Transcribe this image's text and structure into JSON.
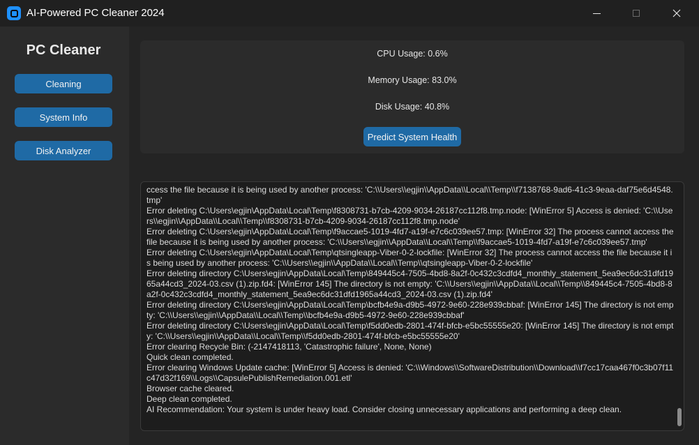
{
  "window": {
    "title": "AI-Powered PC Cleaner 2024"
  },
  "sidebar": {
    "title": "PC Cleaner",
    "items": [
      {
        "label": "Cleaning"
      },
      {
        "label": "System Info"
      },
      {
        "label": "Disk Analyzer"
      }
    ]
  },
  "stats": {
    "cpu": "CPU Usage: 0.6%",
    "memory": "Memory Usage: 83.0%",
    "disk": "Disk Usage: 40.8%",
    "predict_label": "Predict System Health"
  },
  "log": {
    "lines": [
      "ccess the file because it is being used by another process: 'C:\\\\Users\\\\egjin\\\\AppData\\\\Local\\\\Temp\\\\f7138768-9ad6-41c3-9eaa-daf75e6d4548.tmp'",
      "Error deleting C:\\Users\\egjin\\AppData\\Local\\Temp\\f8308731-b7cb-4209-9034-26187cc112f8.tmp.node: [WinError 5] Access is denied: 'C:\\\\Users\\\\egjin\\\\AppData\\\\Local\\\\Temp\\\\f8308731-b7cb-4209-9034-26187cc112f8.tmp.node'",
      "Error deleting C:\\Users\\egjin\\AppData\\Local\\Temp\\f9accae5-1019-4fd7-a19f-e7c6c039ee57.tmp: [WinError 32] The process cannot access the file because it is being used by another process: 'C:\\\\Users\\\\egjin\\\\AppData\\\\Local\\\\Temp\\\\f9accae5-1019-4fd7-a19f-e7c6c039ee57.tmp'",
      "Error deleting C:\\Users\\egjin\\AppData\\Local\\Temp\\qtsingleapp-Viber-0-2-lockfile: [WinError 32] The process cannot access the file because it is being used by another process: 'C:\\\\Users\\\\egjin\\\\AppData\\\\Local\\\\Temp\\\\qtsingleapp-Viber-0-2-lockfile'",
      "Error deleting directory C:\\Users\\egjin\\AppData\\Local\\Temp\\849445c4-7505-4bd8-8a2f-0c432c3cdfd4_monthly_statement_5ea9ec6dc31dfd1965a44cd3_2024-03.csv (1).zip.fd4: [WinError 145] The directory is not empty: 'C:\\\\Users\\\\egjin\\\\AppData\\\\Local\\\\Temp\\\\849445c4-7505-4bd8-8a2f-0c432c3cdfd4_monthly_statement_5ea9ec6dc31dfd1965a44cd3_2024-03.csv (1).zip.fd4'",
      "Error deleting directory C:\\Users\\egjin\\AppData\\Local\\Temp\\bcfb4e9a-d9b5-4972-9e60-228e939cbbaf: [WinError 145] The directory is not empty: 'C:\\\\Users\\\\egjin\\\\AppData\\\\Local\\\\Temp\\\\bcfb4e9a-d9b5-4972-9e60-228e939cbbaf'",
      "Error deleting directory C:\\Users\\egjin\\AppData\\Local\\Temp\\f5dd0edb-2801-474f-bfcb-e5bc55555e20: [WinError 145] The directory is not empty: 'C:\\\\Users\\\\egjin\\\\AppData\\\\Local\\\\Temp\\\\f5dd0edb-2801-474f-bfcb-e5bc55555e20'",
      "Error clearing Recycle Bin: (-2147418113, 'Catastrophic failure', None, None)",
      "Quick clean completed.",
      "Error clearing Windows Update cache: [WinError 5] Access is denied: 'C:\\\\Windows\\\\SoftwareDistribution\\\\Download\\\\f7cc17caa467f0c3b07f11c47d32f169\\\\Logs\\\\CapsulePublishRemediation.001.etl'",
      "Browser cache cleared.",
      "Deep clean completed.",
      "AI Recommendation: Your system is under heavy load. Consider closing unnecessary applications and performing a deep clean."
    ]
  }
}
